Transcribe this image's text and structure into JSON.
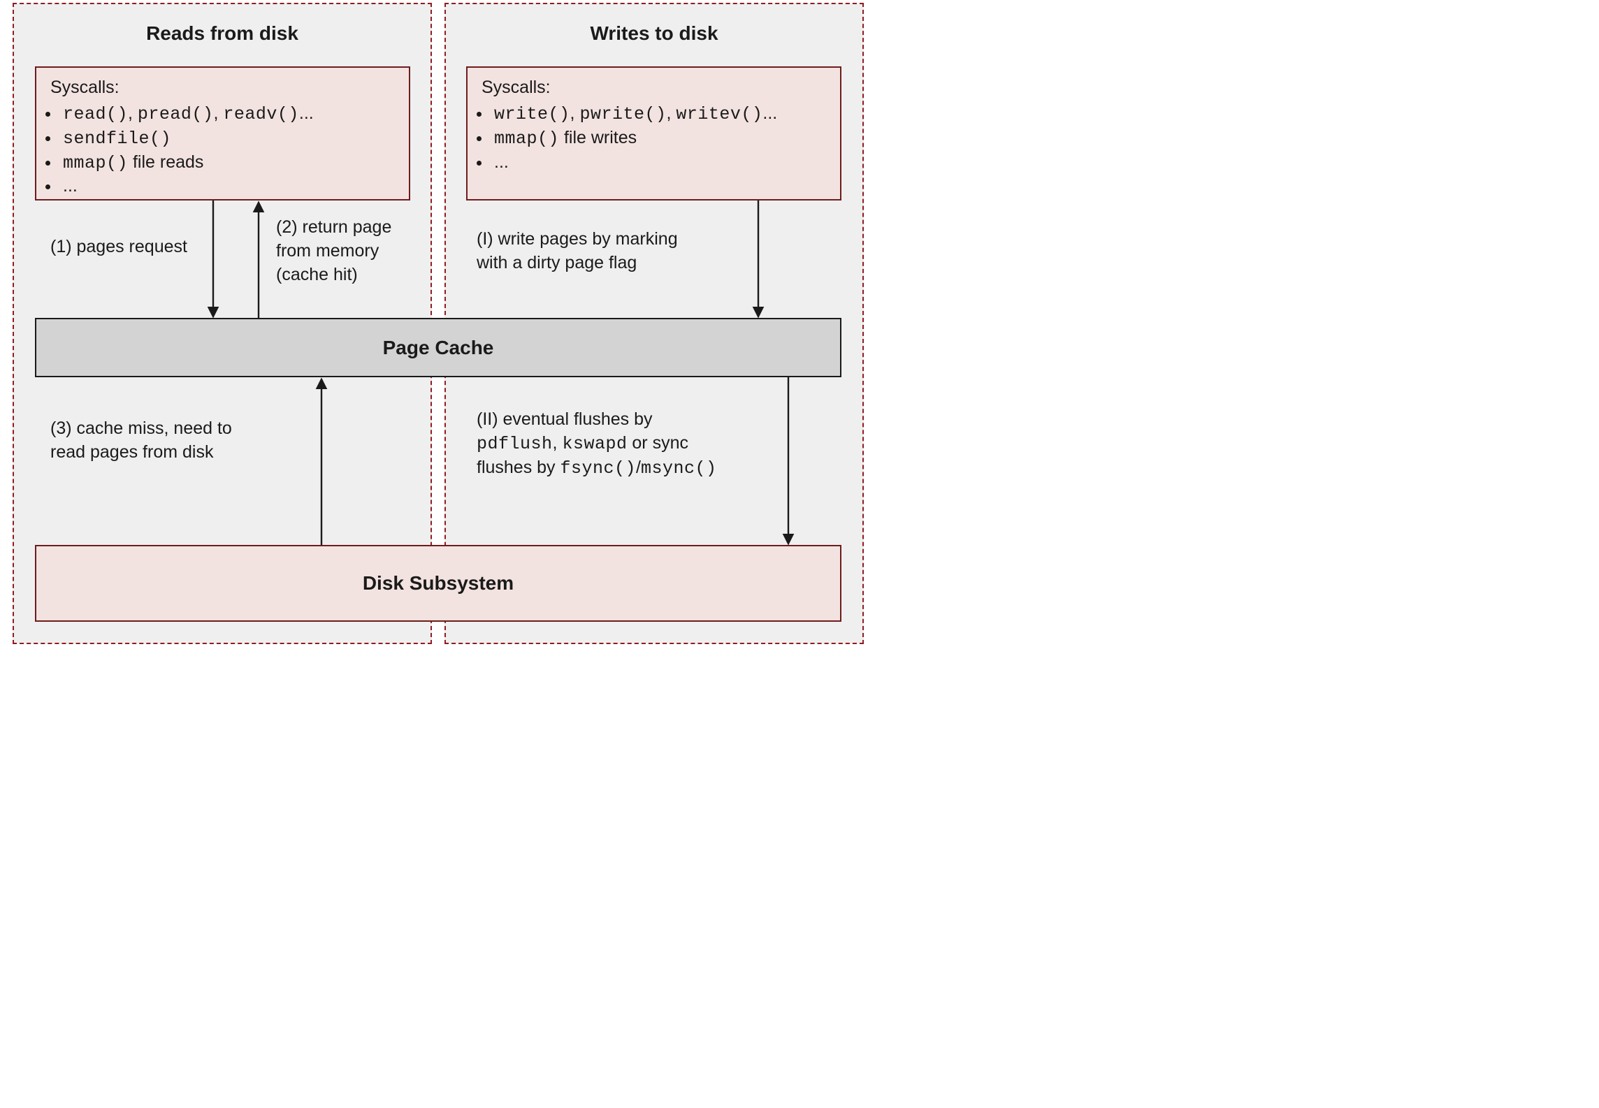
{
  "panels": {
    "reads": {
      "title": "Reads from disk"
    },
    "writes": {
      "title": "Writes to disk"
    }
  },
  "syscalls": {
    "reads": {
      "heading": "Syscalls:",
      "items_html": [
        "<span class='mono'>read()</span>, <span class='mono'>pread()</span>, <span class='mono'>readv()</span>...",
        "<span class='mono'>sendfile()</span>",
        "<span class='mono'>mmap()</span> file reads",
        "..."
      ]
    },
    "writes": {
      "heading": "Syscalls:",
      "items_html": [
        "<span class='mono'>write()</span>, <span class='mono'>pwrite()</span>, <span class='mono'>writev()</span>...",
        "<span class='mono'>mmap()</span> file writes",
        "..."
      ]
    }
  },
  "blocks": {
    "page_cache": "Page Cache",
    "disk_subsystem": "Disk Subsystem"
  },
  "labels": {
    "l1": "(1) pages request",
    "l2_html": "(2) return page<br>from memory<br>(cache hit)",
    "l3_html": "(3) cache miss, need to<br>read pages from disk",
    "lI_html": "(I) write pages by marking<br>with a dirty page flag",
    "lII_html": "(II) eventual flushes by<br><span class='mono'>pdflush</span>, <span class='mono'>kswapd</span> or sync<br>flushes by <span class='mono'>fsync()</span>/<span class='mono'>msync()</span>"
  },
  "colors": {
    "dashed_border": "#8f1d21",
    "panel_bg": "#efefef",
    "box_bg": "#f3e3e0",
    "box_border": "#6e1c1c",
    "cache_bg": "#d3d3d3"
  }
}
